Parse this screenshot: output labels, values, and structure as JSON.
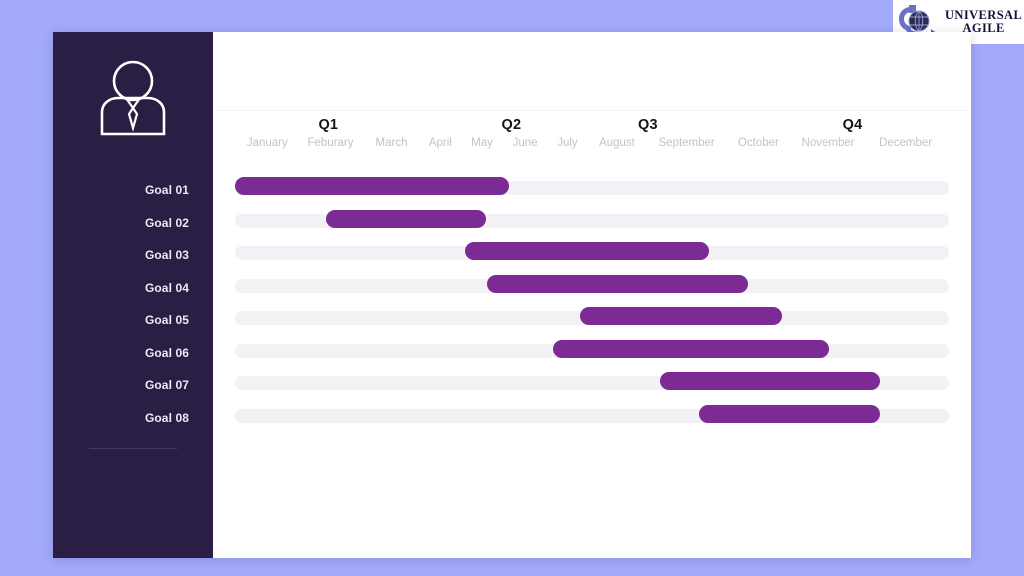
{
  "brand": {
    "logo_icon": "globe-arrow-icon",
    "name_line1": "UNIVERSAL",
    "trademark": "™",
    "name_line2": "AGILE"
  },
  "sidebar": {
    "avatar_icon": "person-avatar-icon",
    "goals": [
      {
        "label": "Goal 01"
      },
      {
        "label": "Goal 02"
      },
      {
        "label": "Goal 03"
      },
      {
        "label": "Goal 04"
      },
      {
        "label": "Goal 05"
      },
      {
        "label": "Goal 06"
      },
      {
        "label": "Goal 07"
      },
      {
        "label": "Goal 08"
      }
    ]
  },
  "timeline": {
    "quarters": [
      {
        "label": "Q1",
        "center_pct": 13.0
      },
      {
        "label": "Q2",
        "center_pct": 38.5
      },
      {
        "label": "Q3",
        "center_pct": 57.5
      },
      {
        "label": "Q4",
        "center_pct": 86.0
      }
    ],
    "months": [
      {
        "label": "January",
        "center_pct": 4.5
      },
      {
        "label": "Feburary",
        "center_pct": 13.3
      },
      {
        "label": "March",
        "center_pct": 21.8
      },
      {
        "label": "April",
        "center_pct": 28.6
      },
      {
        "label": "May",
        "center_pct": 34.4
      },
      {
        "label": "June",
        "center_pct": 40.4
      },
      {
        "label": "July",
        "center_pct": 46.3
      },
      {
        "label": "August",
        "center_pct": 53.2
      },
      {
        "label": "September",
        "center_pct": 62.9
      },
      {
        "label": "October",
        "center_pct": 72.9
      },
      {
        "label": "November",
        "center_pct": 82.6
      },
      {
        "label": "December",
        "center_pct": 93.4
      }
    ]
  },
  "colors": {
    "page_background": "#a3aafa",
    "card_background": "#ffffff",
    "sidebar_background": "#2a1e44",
    "bar_fill": "#7c2b94",
    "bar_track": "#f3f0f6",
    "quarter_text": "#16161a",
    "month_text": "#c3c2cb",
    "goal_text": "#eceaf4"
  },
  "chart_data": {
    "type": "bar",
    "title": "",
    "xlabel": "",
    "ylabel": "",
    "grid": false,
    "legend": "none",
    "axis_categories": [
      "January",
      "Feburary",
      "March",
      "April",
      "May",
      "June",
      "July",
      "August",
      "September",
      "October",
      "November",
      "December"
    ],
    "quarter_groups": [
      "Q1",
      "Q2",
      "Q3",
      "Q4"
    ],
    "categories": [
      "Goal 01",
      "Goal 02",
      "Goal 03",
      "Goal 04",
      "Goal 05",
      "Goal 06",
      "Goal 07",
      "Goal 08"
    ],
    "bars": [
      {
        "goal": "Goal 01",
        "start_pct": 0.0,
        "end_pct": 38.4
      },
      {
        "goal": "Goal 02",
        "start_pct": 12.8,
        "end_pct": 35.2
      },
      {
        "goal": "Goal 03",
        "start_pct": 32.2,
        "end_pct": 66.4
      },
      {
        "goal": "Goal 04",
        "start_pct": 35.3,
        "end_pct": 71.8
      },
      {
        "goal": "Goal 05",
        "start_pct": 48.3,
        "end_pct": 76.6
      },
      {
        "goal": "Goal 06",
        "start_pct": 44.5,
        "end_pct": 83.2
      },
      {
        "goal": "Goal 07",
        "start_pct": 59.5,
        "end_pct": 90.4
      },
      {
        "goal": "Goal 08",
        "start_pct": 65.0,
        "end_pct": 90.4
      }
    ]
  }
}
